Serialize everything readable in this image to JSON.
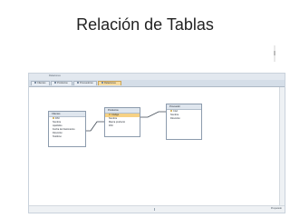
{
  "slide": {
    "title": "Relación de Tablas"
  },
  "window": {
    "ribbon_text": "Relaciones"
  },
  "tabs": [
    {
      "label": "Clientes"
    },
    {
      "label": "Productos"
    },
    {
      "label": "Proveedores"
    },
    {
      "label": "Relaciones"
    }
  ],
  "status": {
    "right_text": "Preparado"
  },
  "tables": [
    {
      "title": "Clientes",
      "fields": [
        "DNI",
        "Nombre",
        "Apellidos",
        "Fecha de Nacimiento",
        "Dirección",
        "Teléfono"
      ]
    },
    {
      "title": "Productos",
      "fields": [
        "Código",
        "Nombre",
        "Marca producto",
        "DNI"
      ]
    },
    {
      "title": "Proveedor",
      "fields": [
        "Cód",
        "Nombre",
        "Dirección"
      ]
    }
  ],
  "colors": {
    "accent_tab": "#f7dca0",
    "selected_field": "#f6d184",
    "relationship_line": "#3c4652"
  }
}
